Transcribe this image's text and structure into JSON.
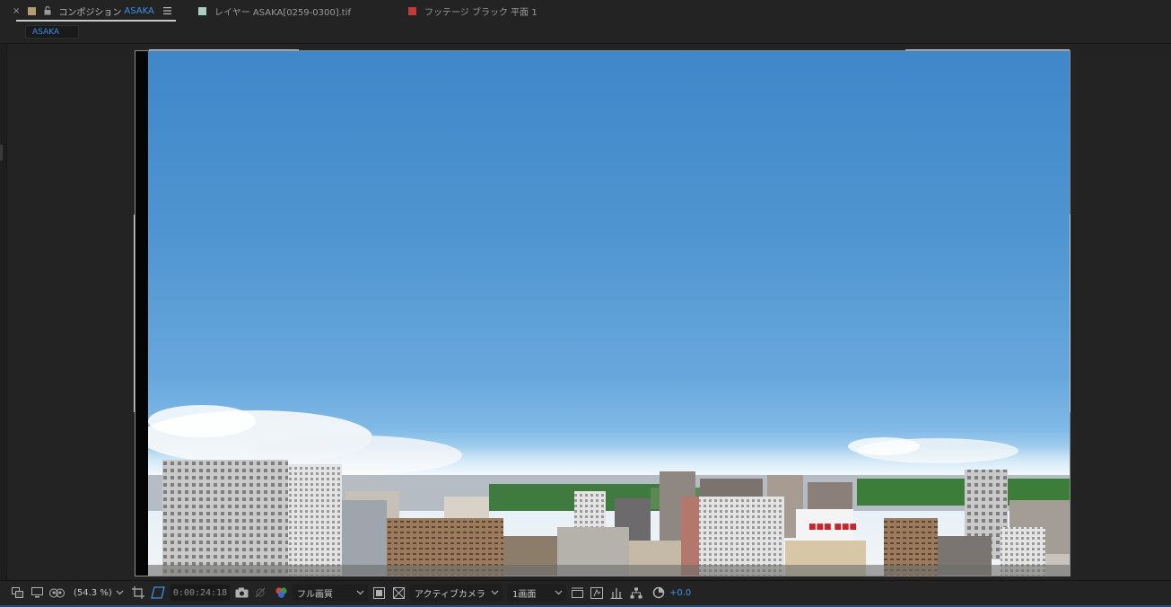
{
  "header": {
    "tabs": [
      {
        "close": "×",
        "label": "コンポジション",
        "accent": "ASAKA",
        "swatch_color": "#b49b72"
      },
      {
        "label": "レイヤー ASAKA[0259-0300].tif",
        "swatch_color": "#a7cfc4"
      },
      {
        "label": "フッテージ ブラック 平面 1",
        "swatch_color": "#c23a3a"
      }
    ],
    "breadcrumb": "ASAKA"
  },
  "toolbar": {
    "zoom": "(54.3 %)",
    "timecode": "0:00:24:18",
    "resolution": "フル画質",
    "camera": "アクティブカメラ",
    "views": "1画面",
    "exposure": "+0.0",
    "accent_color": "#3b8fe6"
  }
}
